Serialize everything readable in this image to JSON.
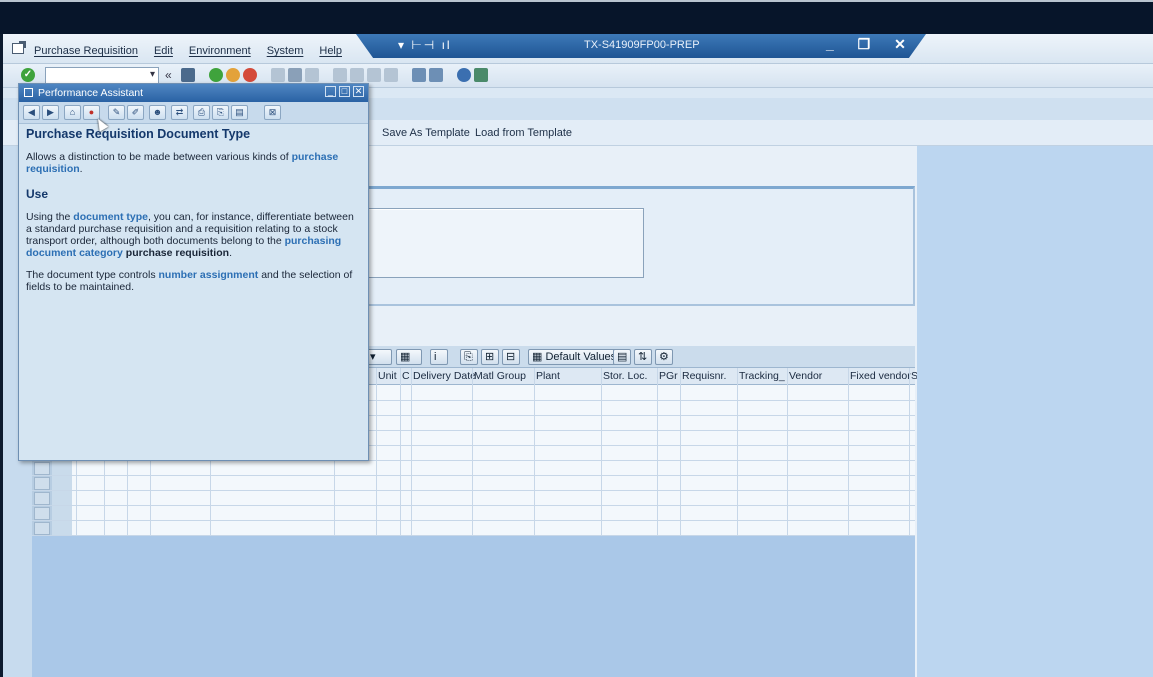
{
  "menubar": {
    "items": [
      "Purchase Requisition",
      "Edit",
      "Environment",
      "System",
      "Help"
    ]
  },
  "titlebar": {
    "system": "TX-S41909FP00-PREP"
  },
  "appbar": {
    "save_template": "Save As Template",
    "load_template": "Load from Template"
  },
  "grid": {
    "default_values_button": "Default Values",
    "columns": [
      "Unit",
      "C",
      "Delivery Date",
      "Matl Group",
      "Plant",
      "Stor. Loc.",
      "PGr",
      "Requisnr.",
      "Tracking_",
      "Vendor",
      "Fixed vendor",
      "S"
    ]
  },
  "assistant": {
    "window_title": "Performance Assistant",
    "heading": "Purchase Requisition Document Type",
    "intro_text": "Allows a distinction to be made between various kinds of ",
    "intro_link": "purchase requisition",
    "intro_end": ".",
    "use_heading": "Use",
    "use_p1_a": "Using the ",
    "use_p1_link1": "document type",
    "use_p1_b": ", you can, for instance, differentiate between a standard purchase requisition and a requisition relating to a stock transport order, although both documents belong to the ",
    "use_p1_link2": "purchasing document category",
    "use_p1_c": " ",
    "use_p1_strong": "purchase requisition",
    "use_p1_end": ".",
    "use_p2_a": "The document type controls ",
    "use_p2_link": "number assignment",
    "use_p2_b": " and the selection of fields to be maintained."
  },
  "colors": {
    "title_blue": "#2a62a4",
    "link_blue": "#2c6fb4",
    "heading_blue": "#14386b",
    "ok_green": "#3fa33c"
  }
}
